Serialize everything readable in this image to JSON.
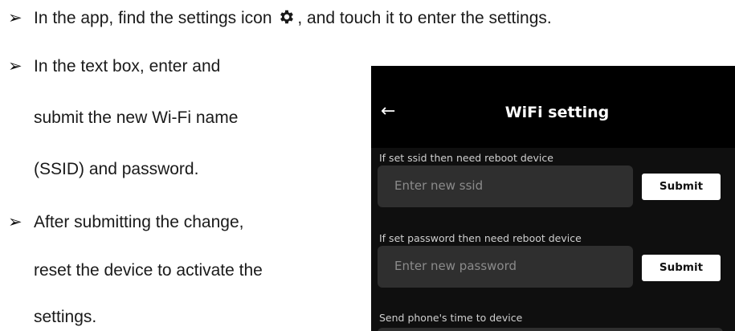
{
  "instructions": {
    "step1_before": "In the app, find the settings icon",
    "step1_after": ", and touch it to enter the settings.",
    "step2_line1": "In the text box, enter and",
    "step2_line2": "submit the new Wi-Fi name",
    "step2_line3": "(SSID) and password.",
    "step3_line1": "After submitting the change,",
    "step3_line2": "reset the device to activate the",
    "step3_line3": "settings.",
    "bullet_glyph": "➢"
  },
  "phone": {
    "back_icon": "←",
    "title": "WiFi setting",
    "ssid_label": "If set ssid then need reboot device",
    "ssid_placeholder": "Enter new ssid",
    "password_label": "If set password then need reboot device",
    "password_placeholder": "Enter new password",
    "submit_label": "Submit",
    "time_label": "Send phone's time to device"
  },
  "icons": {
    "settings": "gear-icon",
    "back": "arrow-left-icon"
  },
  "colors": {
    "phone_bg": "#000000",
    "field_bg": "#2f2f2f",
    "button_bg": "#ffffff"
  }
}
